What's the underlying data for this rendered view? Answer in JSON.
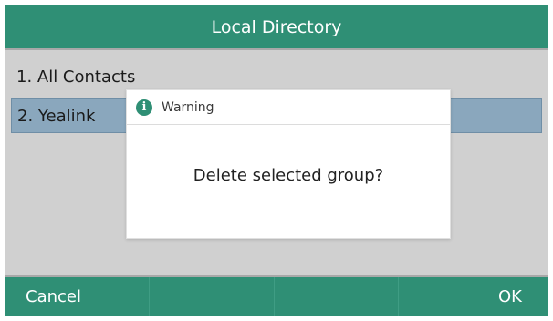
{
  "header": {
    "title": "Local Directory"
  },
  "list": {
    "items": [
      {
        "label": "1. All Contacts"
      },
      {
        "label": "2. Yealink"
      }
    ],
    "selected_index": 1
  },
  "dialog": {
    "icon": "info-icon",
    "title": "Warning",
    "message": "Delete selected group?"
  },
  "softkeys": {
    "keys": [
      "Cancel",
      "",
      "",
      "OK"
    ]
  },
  "colors": {
    "accent": "#2f8f75",
    "selection": "#8aa7bd",
    "background": "#d0d0d0"
  }
}
